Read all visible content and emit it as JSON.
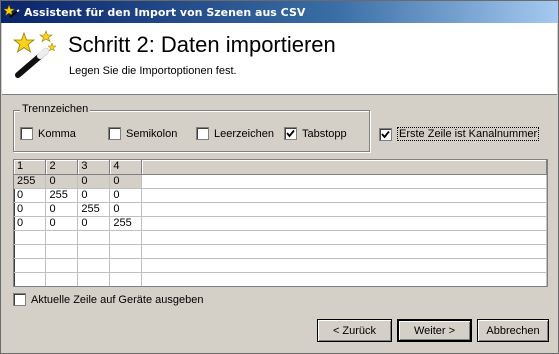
{
  "window": {
    "title": "Assistent für den Import von Szenen aus CSV",
    "icon": "wizard-app-icon"
  },
  "header": {
    "step_title": "Schritt 2: Daten importieren",
    "step_subtitle": "Legen Sie die Importoptionen fest.",
    "icon": "magic-wand-icon"
  },
  "separators": {
    "group_label": "Trennzeichen",
    "options": [
      {
        "label": "Komma",
        "checked": false
      },
      {
        "label": "Semikolon",
        "checked": false
      },
      {
        "label": "Leerzeichen",
        "checked": false
      },
      {
        "label": "Tabstopp",
        "checked": true
      }
    ]
  },
  "first_row_channel": {
    "label": "Erste Zeile ist Kanalnummer",
    "checked": true
  },
  "table": {
    "columns": [
      "1",
      "2",
      "3",
      "4"
    ],
    "rows": [
      [
        "255",
        "0",
        "0",
        "0"
      ],
      [
        "0",
        "255",
        "0",
        "0"
      ],
      [
        "0",
        "0",
        "255",
        "0"
      ],
      [
        "0",
        "0",
        "0",
        "255"
      ]
    ],
    "selected_row": 0
  },
  "output_current_row": {
    "label": "Aktuelle Zeile auf Geräte ausgeben",
    "checked": false
  },
  "buttons": {
    "back": "< Zurück",
    "next": "Weiter >",
    "cancel": "Abbrechen"
  }
}
